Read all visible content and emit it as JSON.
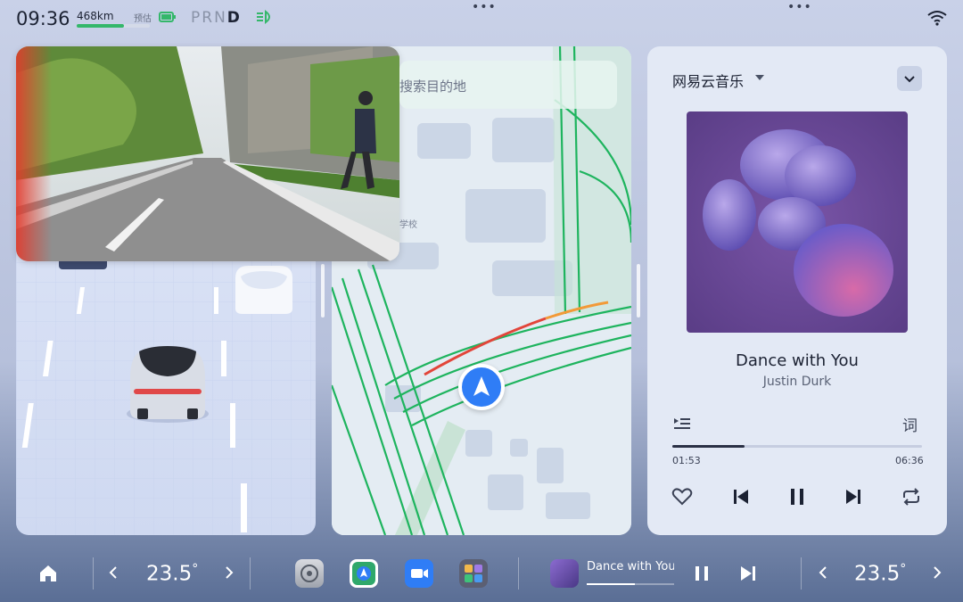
{
  "status": {
    "time": "09:36",
    "range": "468km",
    "range_fraction": 0.65,
    "estimate_label": "预估",
    "gears": [
      "P",
      "R",
      "N",
      "D"
    ],
    "active_gear": "D",
    "icons": [
      "battery-icon",
      "headlight-icon",
      "wifi-icon"
    ]
  },
  "map": {
    "search_placeholder": "搜索目的地",
    "poi_label": "学校"
  },
  "music": {
    "app_name": "网易云音乐",
    "song_title": "Dance with You",
    "artist": "Justin Durk",
    "current_time": "01:53",
    "total_time": "06:36",
    "progress": 0.29,
    "lyrics_label": "词",
    "controls": [
      "playlist-icon",
      "like-icon",
      "previous-icon",
      "pause-icon",
      "next-icon",
      "repeat-icon"
    ]
  },
  "dock": {
    "left_temp": "23.5",
    "right_temp": "23.5",
    "temp_unit": "°",
    "apps": [
      "settings-app-icon",
      "navigation-app-icon",
      "video-call-app-icon",
      "apps-grid-icon"
    ],
    "mini_player_title": "Dance with You",
    "mini_progress": 0.55
  },
  "colors": {
    "accent": "#2f7df6",
    "route_green": "#1eb45e",
    "traffic_red": "#e2453a",
    "traffic_orange": "#f29a38"
  }
}
